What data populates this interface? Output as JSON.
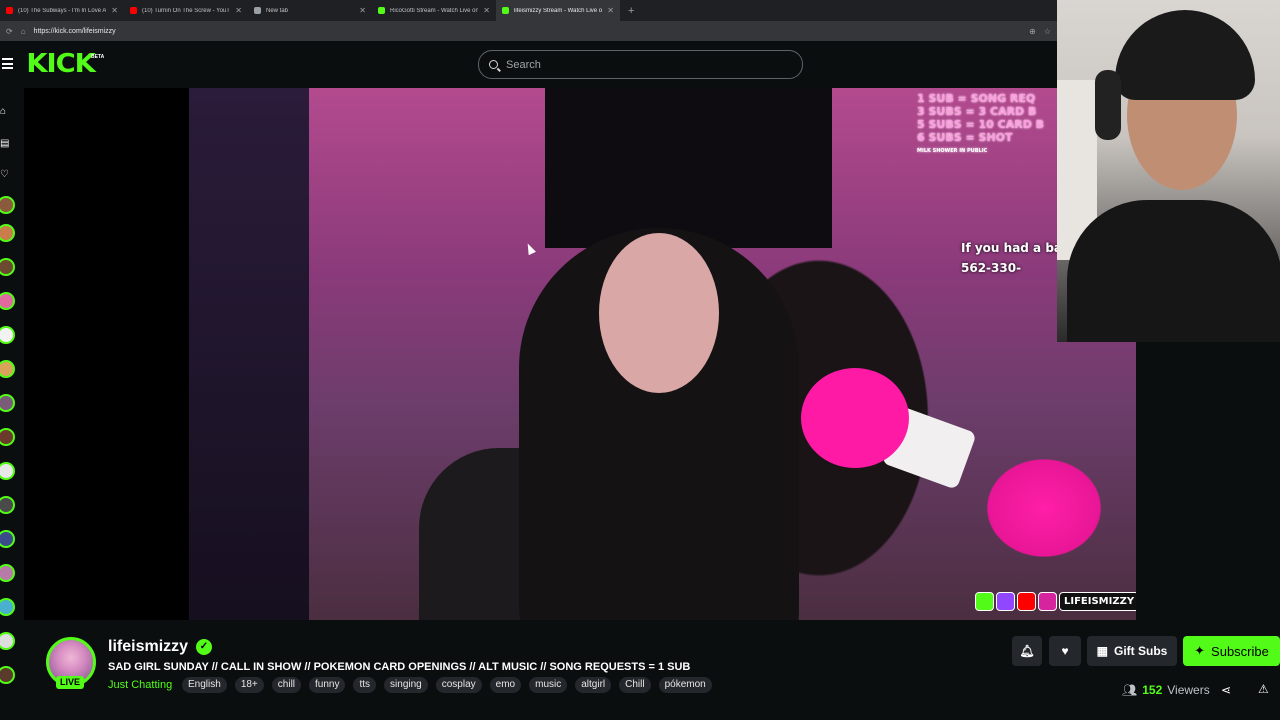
{
  "browser": {
    "tabs": [
      {
        "title": "(10) The Subways - I'm In Love An",
        "favicon_color": "#ff0000",
        "active": false
      },
      {
        "title": "(10) Turnin On The Screw - YouTub",
        "favicon_color": "#ff0000",
        "active": false
      },
      {
        "title": "New tab",
        "favicon_color": "#9aa0a6",
        "active": false
      },
      {
        "title": "RicoGotti Stream - Watch Live on",
        "favicon_color": "#53fc18",
        "active": false
      },
      {
        "title": "lifeismizzy Stream - Watch Live o",
        "favicon_color": "#53fc18",
        "active": true
      }
    ],
    "close_glyph": "✕",
    "new_tab_glyph": "+",
    "url": "https://kick.com/lifeismizzy"
  },
  "header": {
    "logo": "KICK",
    "logo_badge": "BETA",
    "search_placeholder": "Search"
  },
  "sidebar": {
    "nav_icons": [
      "home-icon",
      "browse-icon",
      "following-icon"
    ],
    "channel_avatars": 15
  },
  "video_overlay": {
    "rules": [
      "1 SUB = SONG REQ",
      "3 SUBS = 3 CARD B",
      "5 SUBS = 10 CARD B",
      "6 SUBS = SHOT"
    ],
    "goal_label": "MILK SHOWER IN PUBLIC",
    "call_text": "If you had a ba",
    "phone": "562-330-",
    "social_handle": "LIFEISMIZZY"
  },
  "channel": {
    "name": "lifeismizzy",
    "verified_glyph": "✓",
    "live_badge": "LIVE",
    "title": "SAD GIRL SUNDAY // CALL IN SHOW // POKEMON CARD OPENINGS // ALT MUSIC // SONG REQUESTS = 1 SUB",
    "category": "Just Chatting",
    "tags": [
      "English",
      "18+",
      "chill",
      "funny",
      "tts",
      "singing",
      "cosplay",
      "emo",
      "music",
      "altgirl",
      "Chill",
      "pókemon"
    ]
  },
  "actions": {
    "gift_label": "Gift Subs",
    "subscribe_label": "Subscribe",
    "viewers_count": "152",
    "viewers_label": "Viewers"
  },
  "colors": {
    "kick_green": "#53fc18",
    "background": "#0b0e0f",
    "chip": "#24272c"
  }
}
